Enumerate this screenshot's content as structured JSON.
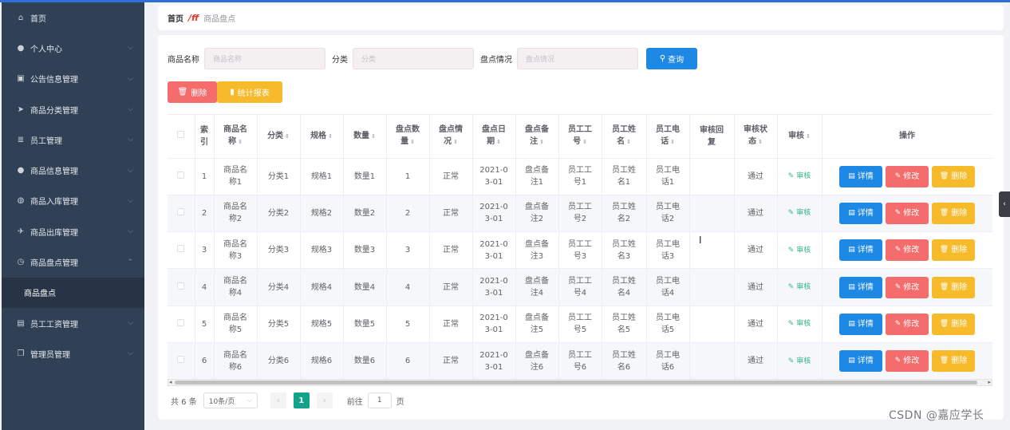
{
  "sidebar": {
    "items": [
      {
        "label": "首页",
        "icon": "home-icon",
        "glyph": "⌂",
        "arrow": ""
      },
      {
        "label": "个人中心",
        "icon": "user-icon",
        "glyph": "●",
        "arrow": "⌵"
      },
      {
        "label": "公告信息管理",
        "icon": "briefcase-icon",
        "glyph": "▣",
        "arrow": "⌵"
      },
      {
        "label": "商品分类管理",
        "icon": "send-icon",
        "glyph": "➤",
        "arrow": "⌵"
      },
      {
        "label": "员工管理",
        "icon": "document-icon",
        "glyph": "≣",
        "arrow": "⌵"
      },
      {
        "label": "商品信息管理",
        "icon": "person-icon",
        "glyph": "●",
        "arrow": "⌵"
      },
      {
        "label": "商品入库管理",
        "icon": "globe-icon",
        "glyph": "◍",
        "arrow": "⌵"
      },
      {
        "label": "商品出库管理",
        "icon": "plane-icon",
        "glyph": "✈",
        "arrow": "⌵"
      },
      {
        "label": "商品盘点管理",
        "icon": "clock-icon",
        "glyph": "◷",
        "arrow": "⌃"
      },
      {
        "label": "商品盘点",
        "icon": "",
        "glyph": "",
        "arrow": "",
        "sub": true
      },
      {
        "label": "员工工资管理",
        "icon": "image-icon",
        "glyph": "▤",
        "arrow": "⌵"
      },
      {
        "label": "管理员管理",
        "icon": "copy-icon",
        "glyph": "❐",
        "arrow": "⌵"
      }
    ]
  },
  "breadcrumb": {
    "home": "首页",
    "sep": "/ff",
    "current": "商品盘点"
  },
  "filters": {
    "name_label": "商品名称",
    "name_placeholder": "商品名称",
    "cat_label": "分类",
    "cat_placeholder": "分类",
    "status_label": "盘点情况",
    "status_placeholder": "盘点情况",
    "query": "查询"
  },
  "actions": {
    "delete": "删除",
    "report": "统计报表"
  },
  "table": {
    "headers": [
      "",
      "索\n引",
      "商品名\n称",
      "分类",
      "规格",
      "数量",
      "盘点数\n量",
      "盘点情\n况",
      "盘点日\n期",
      "盘点备\n注",
      "员工工\n号",
      "员工姓\n名",
      "员工电\n话",
      "审核回\n复",
      "审核状\n态",
      "审核",
      "操作"
    ],
    "rows": [
      [
        "1",
        "商品名\n称1",
        "分类1",
        "规格1",
        "数量1",
        "1",
        "正常",
        "2021-0\n3-01",
        "盘点备\n注1",
        "员工工\n号1",
        "员工姓\n名1",
        "员工电\n话1",
        "",
        "通过",
        "审核"
      ],
      [
        "2",
        "商品名\n称2",
        "分类2",
        "规格2",
        "数量2",
        "2",
        "正常",
        "2021-0\n3-01",
        "盘点备\n注2",
        "员工工\n号2",
        "员工姓\n名2",
        "员工电\n话2",
        "",
        "通过",
        "审核"
      ],
      [
        "3",
        "商品名\n称3",
        "分类3",
        "规格3",
        "数量3",
        "3",
        "正常",
        "2021-0\n3-01",
        "盘点备\n注3",
        "员工工\n号3",
        "员工姓\n名3",
        "员工电\n话3",
        "",
        "通过",
        "审核"
      ],
      [
        "4",
        "商品名\n称4",
        "分类4",
        "规格4",
        "数量4",
        "4",
        "正常",
        "2021-0\n3-01",
        "盘点备\n注4",
        "员工工\n号4",
        "员工姓\n名4",
        "员工电\n话4",
        "",
        "通过",
        "审核"
      ],
      [
        "5",
        "商品名\n称5",
        "分类5",
        "规格5",
        "数量5",
        "5",
        "正常",
        "2021-0\n3-01",
        "盘点备\n注5",
        "员工工\n号5",
        "员工姓\n名5",
        "员工电\n话5",
        "",
        "通过",
        "审核"
      ],
      [
        "6",
        "商品名\n称6",
        "分类6",
        "规格6",
        "数量6",
        "6",
        "正常",
        "2021-0\n3-01",
        "盘点备\n注6",
        "员工工\n号6",
        "员工姓\n名6",
        "员工电\n话6",
        "",
        "通过",
        "审核"
      ]
    ],
    "ops": {
      "detail": "详情",
      "edit": "修改",
      "delete": "删除"
    }
  },
  "pager": {
    "total": "共 6 条",
    "size": "10条/页",
    "page": "1",
    "goto_pre": "前往",
    "goto_val": "1",
    "goto_post": "页"
  },
  "watermark": "CSDN @嘉应学长",
  "colors": {
    "sidebar": "#304156",
    "primary": "#1e88e5",
    "danger": "#f56c6c",
    "warning": "#f7ba2a",
    "pager_active": "#13a38b"
  }
}
